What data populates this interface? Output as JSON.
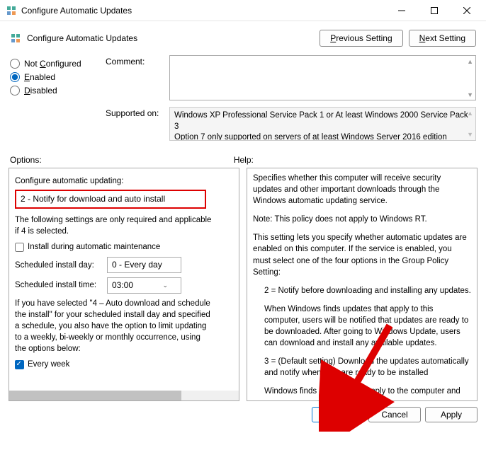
{
  "window": {
    "title": "Configure Automatic Updates"
  },
  "header": {
    "title": "Configure Automatic Updates",
    "previous_btn": "Previous Setting",
    "next_btn": "Next Setting"
  },
  "state_radios": {
    "not_configured": "Not Configured",
    "enabled": "Enabled",
    "disabled": "Disabled"
  },
  "fields": {
    "comment_label": "Comment:",
    "comment_value": "",
    "supported_label": "Supported on:",
    "supported_value": "Windows XP Professional Service Pack 1 or At least Windows 2000 Service Pack 3\nOption 7 only supported on servers of at least Windows Server 2016 edition"
  },
  "sections": {
    "options_label": "Options:",
    "help_label": "Help:"
  },
  "options": {
    "configure_label": "Configure automatic updating:",
    "configure_value": "2 - Notify for download and auto install",
    "following_text": "The following settings are only required and applicable if 4 is selected.",
    "install_maint": "Install during automatic maintenance",
    "sched_day_label": "Scheduled install day:",
    "sched_day_value": "0 - Every day",
    "sched_time_label": "Scheduled install time:",
    "sched_time_value": "03:00",
    "sched_note": "If you have selected \"4 – Auto download and schedule the install\" for your scheduled install day and specified a schedule, you also have the option to limit updating to a weekly, bi-weekly or monthly occurrence, using the options below:",
    "every_week": "Every week"
  },
  "help": {
    "p1": "Specifies whether this computer will receive security updates and other important downloads through the Windows automatic updating service.",
    "p2": "Note: This policy does not apply to Windows RT.",
    "p3": "This setting lets you specify whether automatic updates are enabled on this computer. If the service is enabled, you must select one of the four options in the Group Policy Setting:",
    "p4": "2 = Notify before downloading and installing any updates.",
    "p5": "When Windows finds updates that apply to this computer, users will be notified that updates are ready to be downloaded. After going to Windows Update, users can download and install any available updates.",
    "p6": "3 = (Default setting) Download the updates automatically and notify when they are ready to be installed",
    "p7": "Windows finds updates that apply to the computer and"
  },
  "footer": {
    "ok": "OK",
    "cancel": "Cancel",
    "apply": "Apply"
  }
}
